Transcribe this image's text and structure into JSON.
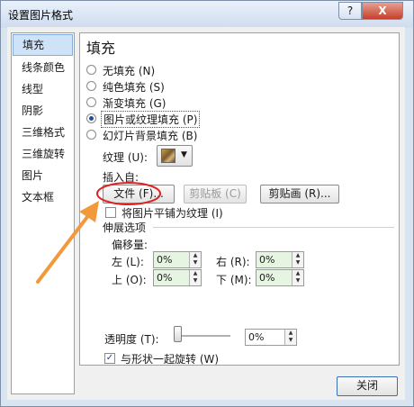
{
  "window": {
    "title": "设置图片格式",
    "help": "?",
    "close": "X"
  },
  "nav": {
    "items": [
      "填充",
      "线条颜色",
      "线型",
      "阴影",
      "三维格式",
      "三维旋转",
      "图片",
      "文本框"
    ]
  },
  "fill": {
    "heading": "填充",
    "options": [
      "无填充 (N)",
      "纯色填充 (S)",
      "渐变填充 (G)",
      "图片或纹理填充 (P)",
      "幻灯片背景填充 (B)"
    ],
    "selected_index": 3,
    "texture_label": "纹理 (U):",
    "texture_icon": "texture-swatch-icon",
    "insert_from_label": "插入自:",
    "file_button": "文件 (F)...",
    "clipboard_button": "剪贴板 (C)",
    "clipart_button": "剪贴画 (R)...",
    "tile_label": "将图片平铺为纹理 (I)",
    "stretch_label": "伸展选项",
    "offset_label": "偏移量:",
    "left_label": "左 (L):",
    "left_value": "0%",
    "right_label": "右 (R):",
    "right_value": "0%",
    "top_label": "上 (O):",
    "top_value": "0%",
    "bottom_label": "下 (M):",
    "bottom_value": "0%",
    "transparency_label": "透明度 (T):",
    "transparency_value": "0%",
    "rotate_label": "与形状一起旋转 (W)",
    "rotate_checked": true
  },
  "footer": {
    "close_button": "关闭"
  },
  "colors": {
    "accent_red": "#e02020",
    "arrow_orange": "#f29a3b"
  }
}
